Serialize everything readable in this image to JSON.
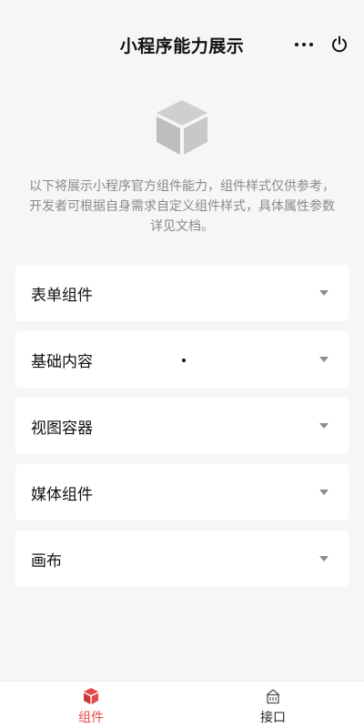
{
  "nav": {
    "title": "小程序能力展示"
  },
  "header": {
    "logo_icon": "cube-icon",
    "intro": "以下将展示小程序官方组件能力，组件样式仅供参考，开发者可根据自身需求自定义组件样式，具体属性参数详见文档。"
  },
  "list": {
    "items": [
      {
        "label": "表单组件"
      },
      {
        "label": "基础内容"
      },
      {
        "label": "视图容器"
      },
      {
        "label": "媒体组件"
      },
      {
        "label": "画布"
      }
    ]
  },
  "tabbar": {
    "tabs": [
      {
        "label": "组件",
        "icon": "cube-icon",
        "active": true
      },
      {
        "label": "接口",
        "icon": "api-icon",
        "active": false
      }
    ]
  },
  "colors": {
    "accent": "#e24a4a",
    "background": "#f6f6f6",
    "muted_text": "#8a8a8a",
    "logo_gray": "#c9c9c9"
  }
}
